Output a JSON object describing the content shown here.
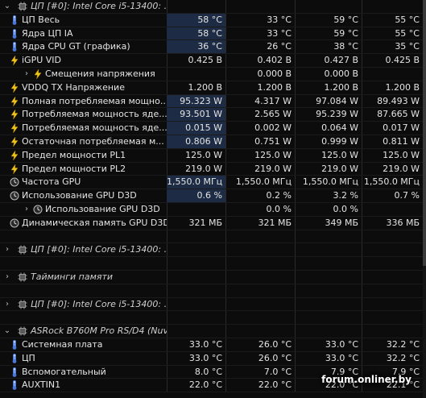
{
  "rows": [
    {
      "type": "header",
      "label": "ЦП [#0]: Intel Core i5-13400: ...",
      "v": [
        "",
        "",
        "",
        ""
      ]
    },
    {
      "type": "data",
      "icon": "thermometer",
      "label": "ЦП Весь",
      "v": [
        "58 °C",
        "33 °C",
        "59 °C",
        "55 °C"
      ],
      "hl": true
    },
    {
      "type": "data",
      "icon": "thermometer",
      "label": "Ядра ЦП IA",
      "v": [
        "58 °C",
        "33 °C",
        "59 °C",
        "55 °C"
      ],
      "hl": true
    },
    {
      "type": "data",
      "icon": "thermometer",
      "label": "Ядра CPU GT (графика)",
      "v": [
        "36 °C",
        "26 °C",
        "38 °C",
        "35 °C"
      ],
      "hl": true
    },
    {
      "type": "data",
      "icon": "bolt",
      "label": "iGPU VID",
      "v": [
        "0.425 В",
        "0.402 В",
        "0.427 В",
        "0.425 В"
      ]
    },
    {
      "type": "sub",
      "icon": "bolt",
      "label": "Смещения напряжения",
      "v": [
        "",
        "0.000 В",
        "0.000 В",
        ""
      ]
    },
    {
      "type": "data",
      "icon": "bolt",
      "label": "VDDQ TX Напряжение",
      "v": [
        "1.200 В",
        "1.200 В",
        "1.200 В",
        "1.200 В"
      ]
    },
    {
      "type": "data",
      "icon": "bolt",
      "label": "Полная потребляемая мощно...",
      "v": [
        "95.323 W",
        "4.317 W",
        "97.084 W",
        "89.493 W"
      ],
      "hl": true
    },
    {
      "type": "data",
      "icon": "bolt",
      "label": "Потребляемая мощность яде...",
      "v": [
        "93.501 W",
        "2.565 W",
        "95.239 W",
        "87.665 W"
      ],
      "hl": true
    },
    {
      "type": "data",
      "icon": "bolt",
      "label": "Потребляемая мощность яде...",
      "v": [
        "0.015 W",
        "0.002 W",
        "0.064 W",
        "0.017 W"
      ],
      "hl": true
    },
    {
      "type": "data",
      "icon": "bolt",
      "label": "Остаточная потребляемая м...",
      "v": [
        "0.806 W",
        "0.751 W",
        "0.999 W",
        "0.811 W"
      ],
      "hl": true
    },
    {
      "type": "data",
      "icon": "bolt",
      "label": "Предел мощности PL1",
      "v": [
        "125.0 W",
        "125.0 W",
        "125.0 W",
        "125.0 W"
      ]
    },
    {
      "type": "data",
      "icon": "bolt",
      "label": "Предел мощности PL2",
      "v": [
        "219.0 W",
        "219.0 W",
        "219.0 W",
        "219.0 W"
      ]
    },
    {
      "type": "data",
      "icon": "clock",
      "label": "Частота GPU",
      "v": [
        "1,550.0 МГц",
        "1,550.0 МГц",
        "1,550.0 МГц",
        "1,550.0 МГц"
      ],
      "hl": true
    },
    {
      "type": "data",
      "icon": "clock",
      "label": "Использование GPU D3D",
      "v": [
        "0.6 %",
        "0.2 %",
        "3.2 %",
        "0.7 %"
      ],
      "hl": true
    },
    {
      "type": "sub",
      "icon": "clock",
      "label": "Использование GPU D3D",
      "v": [
        "",
        "0.0 %",
        "0.0 %",
        ""
      ]
    },
    {
      "type": "data",
      "icon": "clock",
      "label": "Динамическая память GPU D3D",
      "v": [
        "321 МБ",
        "321 МБ",
        "349 МБ",
        "336 МБ"
      ]
    },
    {
      "type": "gap"
    },
    {
      "type": "header",
      "label": "ЦП [#0]: Intel Core i5-13400: ...",
      "collapsed": true,
      "v": [
        "",
        "",
        "",
        ""
      ]
    },
    {
      "type": "gap"
    },
    {
      "type": "header",
      "label": "Тайминги памяти",
      "collapsed": true,
      "v": [
        "",
        "",
        "",
        ""
      ]
    },
    {
      "type": "gap"
    },
    {
      "type": "header",
      "label": "ЦП [#0]: Intel Core i5-13400: ...",
      "collapsed": true,
      "v": [
        "",
        "",
        "",
        ""
      ]
    },
    {
      "type": "gap"
    },
    {
      "type": "header",
      "label": "ASRock B760M Pro RS/D4 (Nuv...",
      "v": [
        "",
        "",
        "",
        ""
      ]
    },
    {
      "type": "data",
      "icon": "thermometer",
      "label": "Системная плата",
      "v": [
        "33.0 °C",
        "26.0 °C",
        "33.0 °C",
        "32.2 °C"
      ]
    },
    {
      "type": "data",
      "icon": "thermometer",
      "label": "ЦП",
      "v": [
        "33.0 °C",
        "26.0 °C",
        "33.0 °C",
        "32.2 °C"
      ]
    },
    {
      "type": "data",
      "icon": "thermometer",
      "label": "Вспомогательный",
      "v": [
        "8.0 °C",
        "7.0 °C",
        "7.9 °C",
        "7.9 °C"
      ]
    },
    {
      "type": "data",
      "icon": "thermometer",
      "label": "AUXTIN1",
      "v": [
        "22.0 °C",
        "22.0 °C",
        "22.0 °C",
        "22.1 °C"
      ]
    }
  ],
  "watermark": "forum.onliner.by",
  "colors": {
    "highlight": "#1d2c44",
    "thermometer": "#4a78d8",
    "bolt": "#f0c419",
    "clock": "#9a9a9a"
  }
}
